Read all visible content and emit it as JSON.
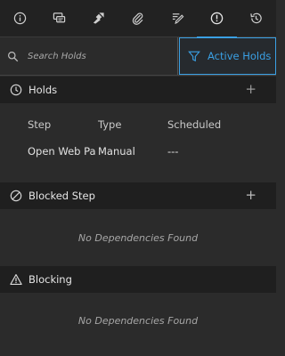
{
  "tabs": [
    {
      "icon": "info-icon"
    },
    {
      "icon": "comments-icon"
    },
    {
      "icon": "tasks-icon"
    },
    {
      "icon": "attachment-icon"
    },
    {
      "icon": "edit-icon"
    },
    {
      "icon": "holds-alert-icon",
      "active": true
    },
    {
      "icon": "history-icon"
    }
  ],
  "search": {
    "placeholder": "Search Holds"
  },
  "filter": {
    "label": "Active Holds"
  },
  "holds": {
    "title": "Holds",
    "columns": [
      "Step",
      "Type",
      "Scheduled"
    ],
    "rows": [
      {
        "step": "Open Web Pa",
        "type": "Manual",
        "scheduled": "---"
      }
    ]
  },
  "blocked_step": {
    "title": "Blocked Step",
    "empty": "No Dependencies Found"
  },
  "blocking": {
    "title": "Blocking",
    "empty": "No Dependencies Found"
  },
  "colors": {
    "accent": "#3aa0e4",
    "background": "#2b2b2b",
    "header": "#1f1f1f"
  }
}
